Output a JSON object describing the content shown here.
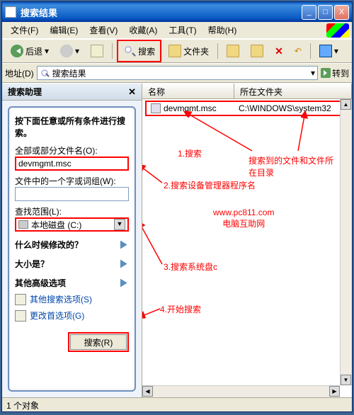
{
  "window": {
    "title": "搜索结果"
  },
  "titlebar_buttons": {
    "min": "_",
    "max": "□",
    "close": "X"
  },
  "menu": [
    "文件(F)",
    "编辑(E)",
    "查看(V)",
    "收藏(A)",
    "工具(T)",
    "帮助(H)"
  ],
  "toolbar": {
    "back": "后退",
    "search": "搜索",
    "folders": "文件夹"
  },
  "addressbar": {
    "label": "地址(D)",
    "value": "搜索结果",
    "go": "转到"
  },
  "panel": {
    "title": "搜索助理",
    "prompt": "按下面任意或所有条件进行搜索。",
    "filename_label": "全部或部分文件名(O):",
    "filename_value": "devmgmt.msc",
    "word_label": "文件中的一个字或词组(W):",
    "word_value": "",
    "lookin_label": "查找范围(L):",
    "lookin_value": "本地磁盘 (C:)",
    "when_label": "什么时候修改的？",
    "size_label": "大小是？",
    "more_label": "其他高级选项",
    "other_search": "其他搜索选项(S)",
    "prefs": "更改首选项(G)",
    "search_button": "搜索(R)"
  },
  "columns": {
    "name": "名称",
    "folder": "所在文件夹"
  },
  "result": {
    "name": "devmgmt.msc",
    "folder": "C:\\WINDOWS\\system32"
  },
  "annotations": {
    "a1": "1.搜索",
    "a2": "2.搜索设备管理器程序名",
    "a3": "3.搜索系统盘c",
    "a4": "4.开始搜索",
    "files": "搜索到的文件和文件所在目录",
    "url": "www.pc811.com",
    "site": "电脑互助网"
  },
  "status": "1 个对象"
}
